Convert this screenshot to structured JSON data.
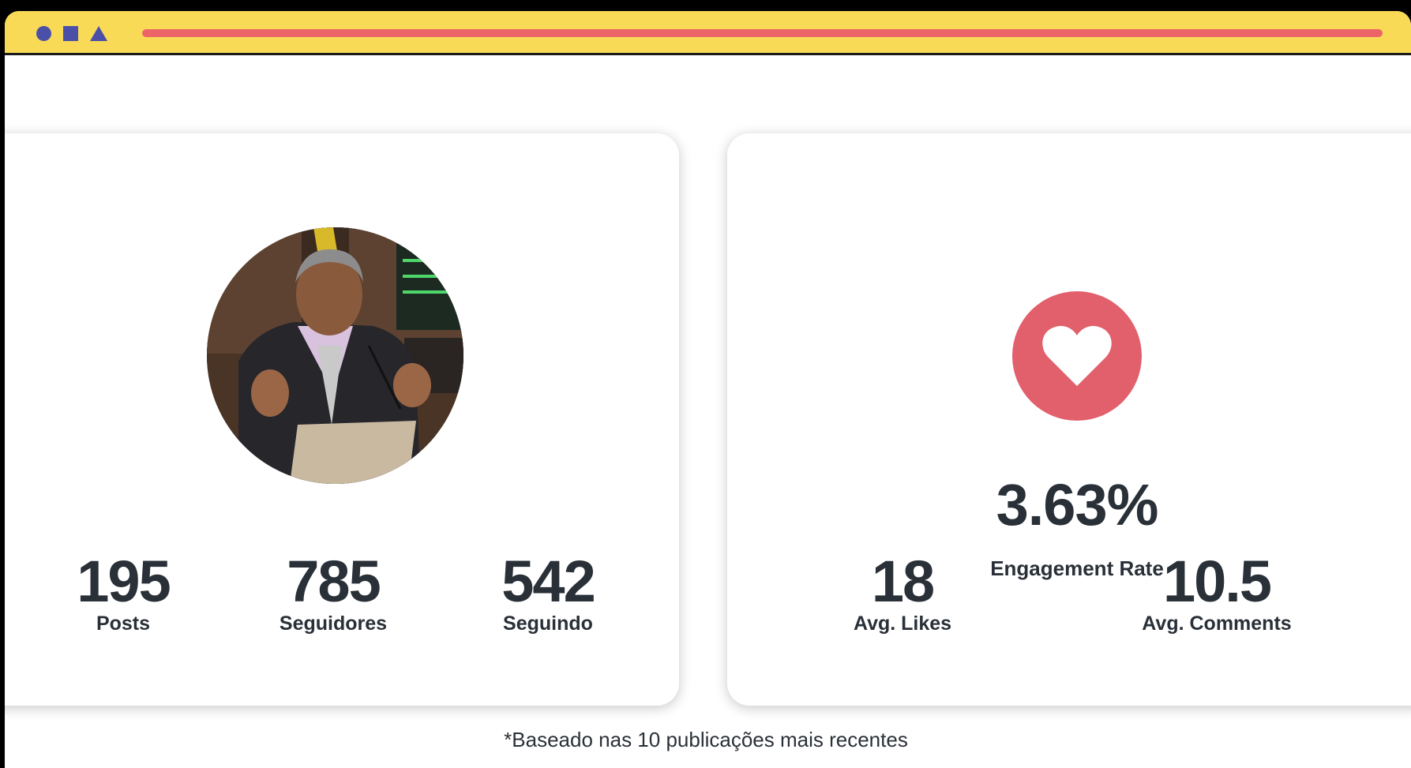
{
  "window": {
    "controls": [
      "circle",
      "square",
      "triangle"
    ],
    "colors": {
      "titlebar": "#f8da57",
      "controls": "#4a4fa8",
      "urlbar": "#ec6468",
      "heart": "#e25f6c",
      "text": "#2a3038"
    }
  },
  "profile": {
    "avatar_icon": "profile-photo",
    "stats": [
      {
        "value": "195",
        "label": "Posts"
      },
      {
        "value": "785",
        "label": "Seguidores"
      },
      {
        "value": "542",
        "label": "Seguindo"
      }
    ]
  },
  "engagement": {
    "icon": "heart-icon",
    "rate": "3.63%",
    "rate_label": "Engagement Rate",
    "stats": [
      {
        "value": "18",
        "label": "Avg. Likes"
      },
      {
        "value": "10.5",
        "label": "Avg. Comments"
      }
    ]
  },
  "footnote": "*Baseado nas 10 publicações mais recentes"
}
